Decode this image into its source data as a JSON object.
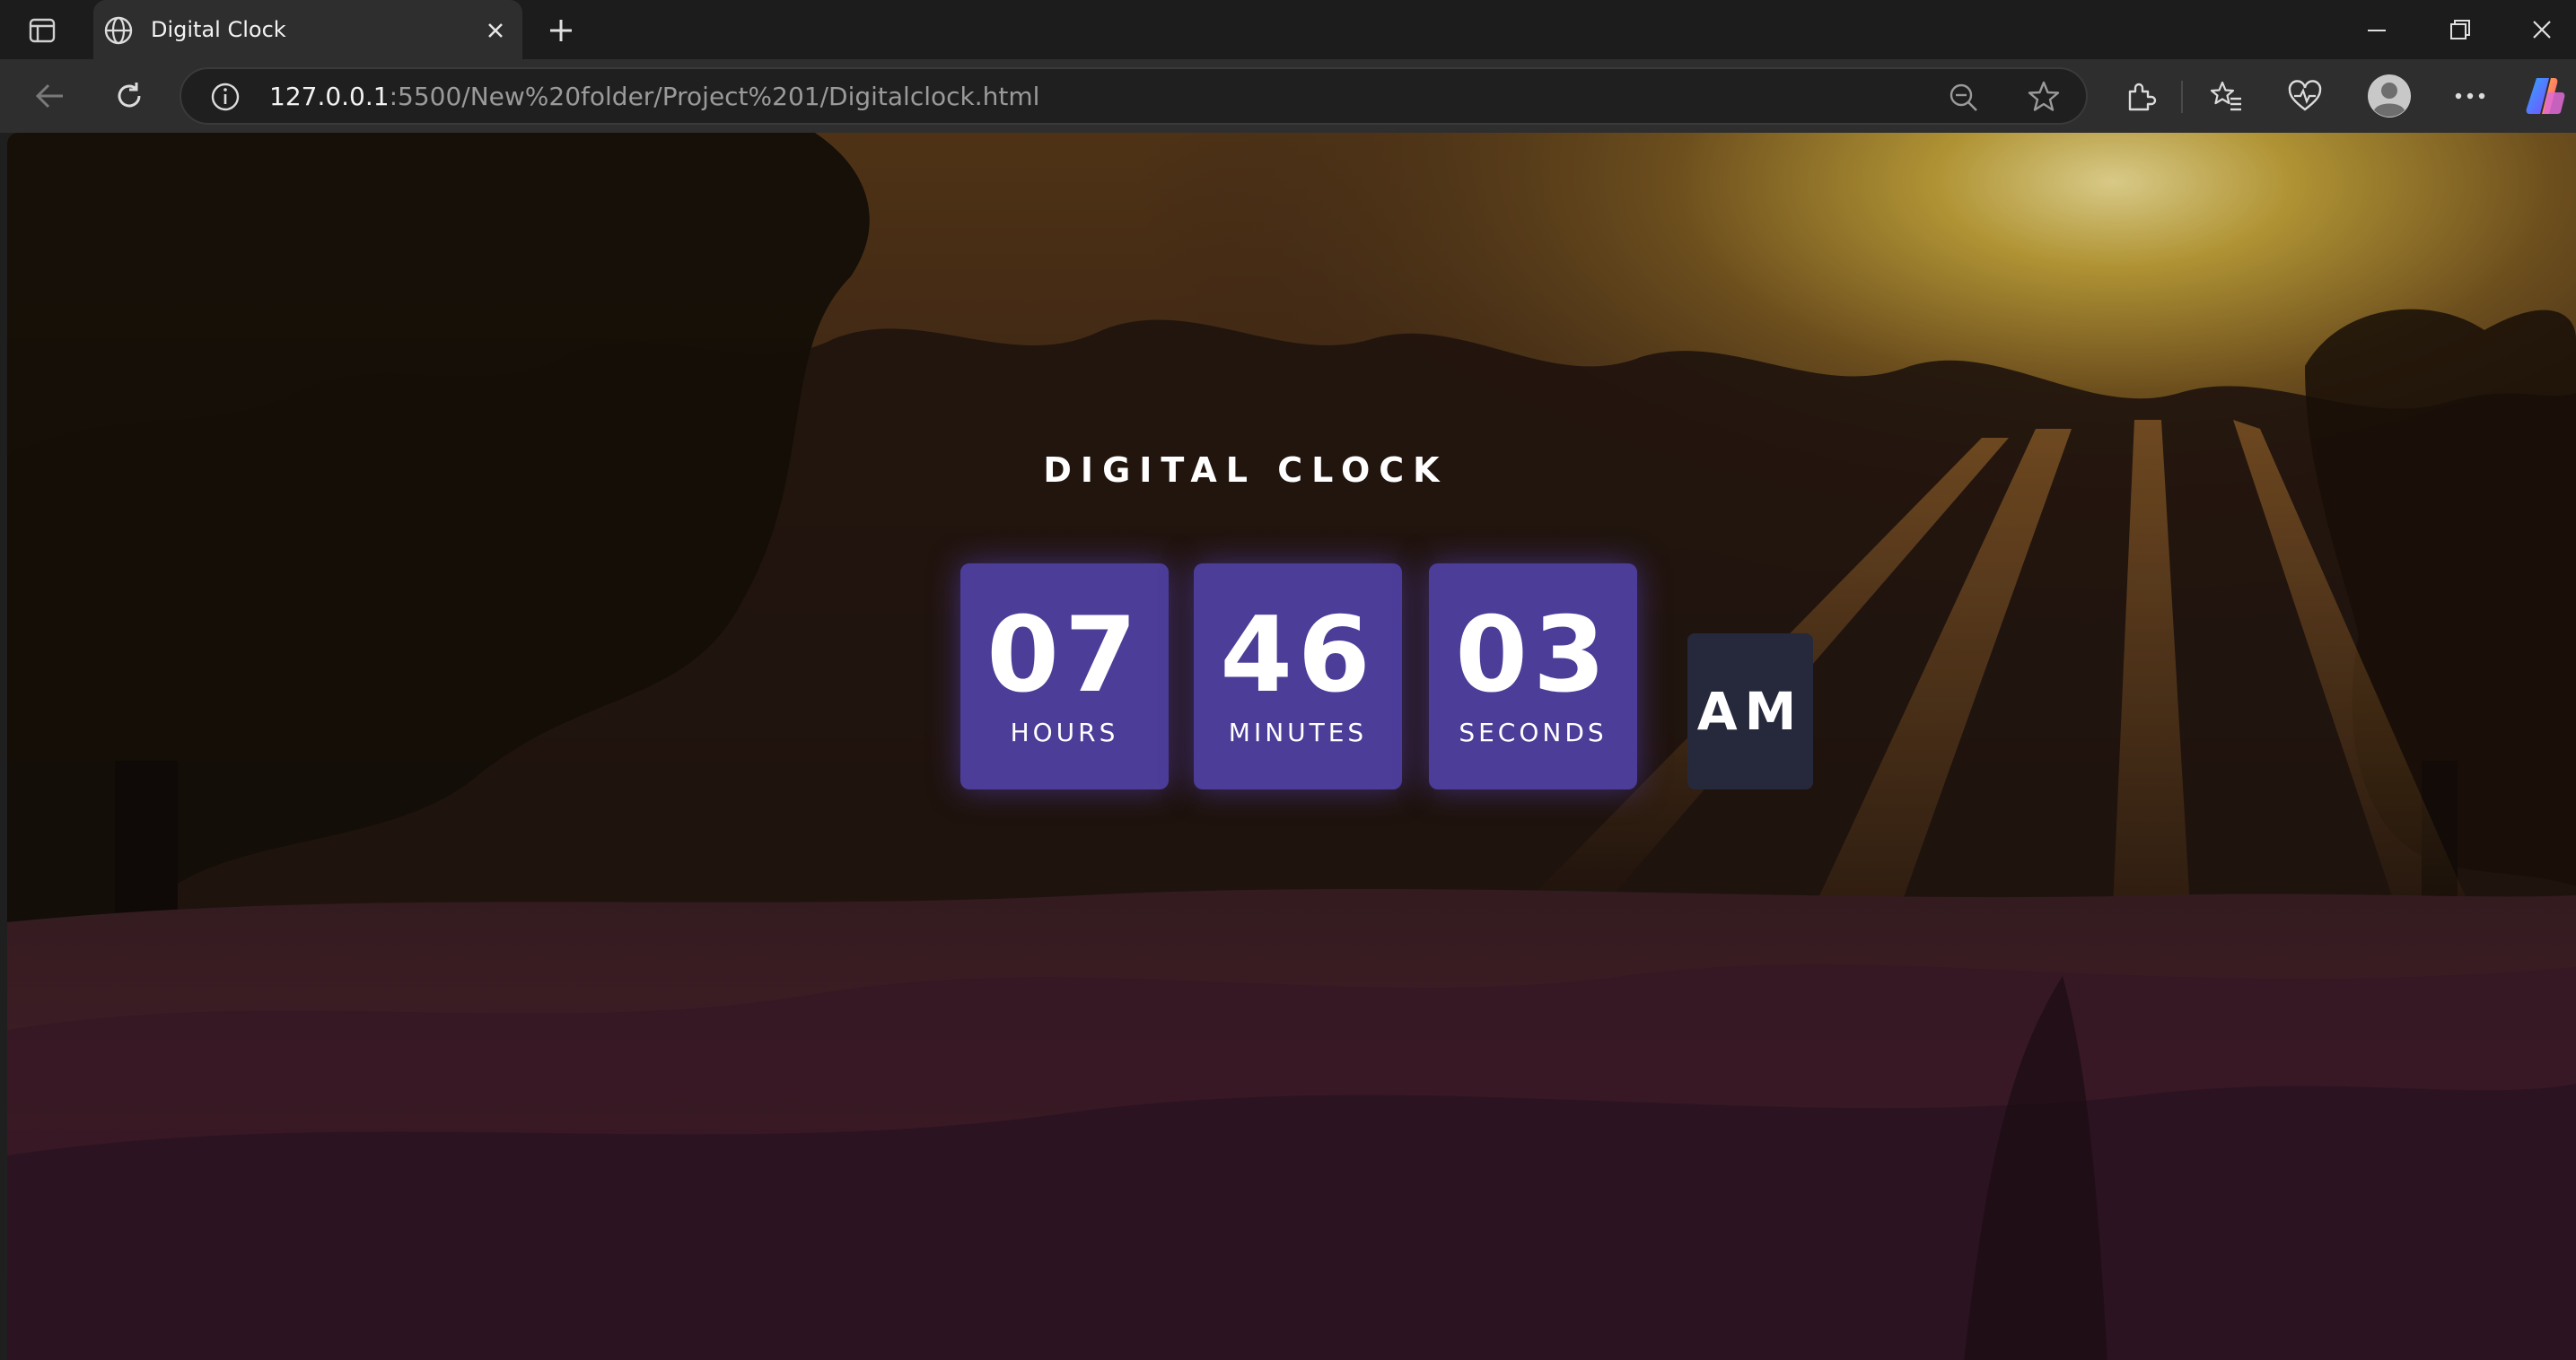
{
  "browser": {
    "tab": {
      "title": "Digital Clock"
    },
    "address": {
      "host": "127.0.0.1",
      "rest": ":5500/New%20folder/Project%201/Digitalclock.html"
    }
  },
  "page": {
    "title": "DIGITAL CLOCK",
    "clock": {
      "hours": {
        "value": "07",
        "label": "HOURS"
      },
      "minutes": {
        "value": "46",
        "label": "MINUTES"
      },
      "seconds": {
        "value": "03",
        "label": "SECONDS"
      },
      "period": "AM"
    },
    "colors": {
      "card": "#4b3d98",
      "period_card": "#26293b"
    }
  }
}
